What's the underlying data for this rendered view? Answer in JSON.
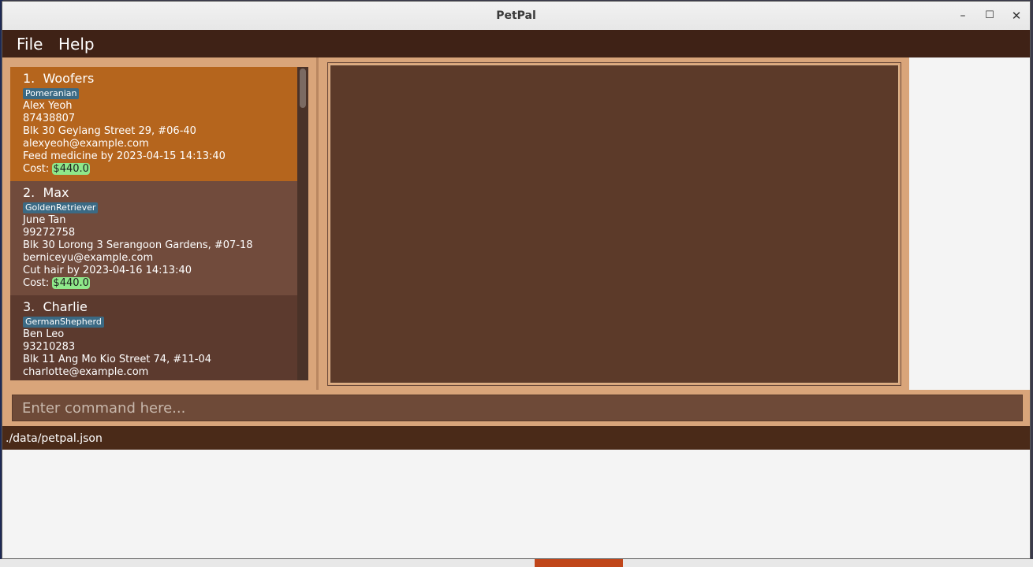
{
  "window": {
    "title": "PetPal"
  },
  "window_controls": {
    "minimize": "–",
    "maximize": "☐",
    "close": "✕"
  },
  "menu": {
    "file": "File",
    "help": "Help"
  },
  "pets": [
    {
      "index": "1.",
      "name": "Woofers",
      "tag": "Pomeranian",
      "owner": "Alex Yeoh",
      "phone": "87438807",
      "address": "Blk 30 Geylang Street 29, #06-40",
      "email": "alexyeoh@example.com",
      "task": "Feed medicine by 2023-04-15 14:13:40",
      "cost_label": "Cost:",
      "cost": "$440.0"
    },
    {
      "index": "2.",
      "name": "Max",
      "tag": "GoldenRetriever",
      "owner": "June Tan",
      "phone": "99272758",
      "address": "Blk 30 Lorong 3 Serangoon Gardens, #07-18",
      "email": "berniceyu@example.com",
      "task": "Cut hair by 2023-04-16 14:13:40",
      "cost_label": "Cost:",
      "cost": "$440.0"
    },
    {
      "index": "3.",
      "name": "Charlie",
      "tag": "GermanShepherd",
      "owner": "Ben Leo",
      "phone": "93210283",
      "address": "Blk 11 Ang Mo Kio Street 74, #11-04",
      "email": "charlotte@example.com"
    }
  ],
  "command": {
    "placeholder": "Enter command here..."
  },
  "status": {
    "path": "./data/petpal.json"
  },
  "colors": {
    "selected_card": "#b5651d",
    "card": "#714b3c",
    "tag": "#3b6a84",
    "cost_badge": "#8fe88a",
    "menubar": "#3f2216"
  }
}
